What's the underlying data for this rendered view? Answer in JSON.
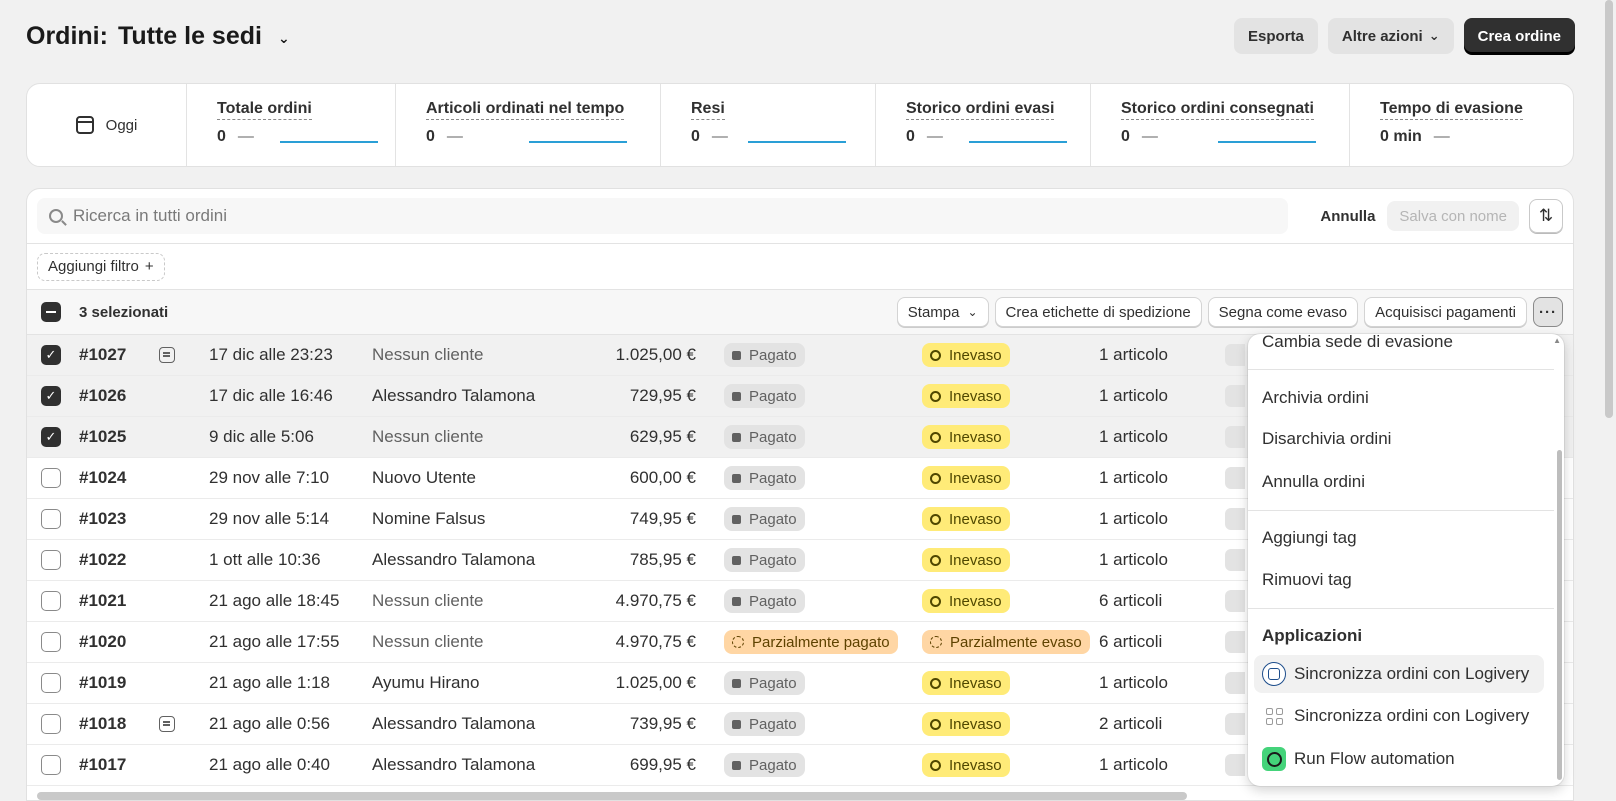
{
  "header": {
    "title_prefix": "Ordini:",
    "title_location": "Tutte le sedi",
    "export_label": "Esporta",
    "more_actions_label": "Altre azioni",
    "create_order_label": "Crea ordine"
  },
  "metrics": {
    "date_label": "Oggi",
    "items": [
      {
        "label": "Totale ordini",
        "value": "0",
        "delta": "—"
      },
      {
        "label": "Articoli ordinati nel tempo",
        "value": "0",
        "delta": "—"
      },
      {
        "label": "Resi",
        "value": "0",
        "delta": "—"
      },
      {
        "label": "Storico ordini evasi",
        "value": "0",
        "delta": "—"
      },
      {
        "label": "Storico ordini consegnati",
        "value": "0",
        "delta": "—"
      },
      {
        "label": "Tempo di evasione",
        "value": "0 min",
        "delta": "—"
      }
    ]
  },
  "search": {
    "placeholder": "Ricerca in tutti ordini",
    "cancel_label": "Annulla",
    "save_label": "Salva con nome"
  },
  "filter": {
    "add_label": "Aggiungi filtro",
    "add_icon": "+"
  },
  "bulk": {
    "count_label": "3 selezionati",
    "print_label": "Stampa",
    "labels_label": "Crea etichette di spedizione",
    "mark_fulfilled_label": "Segna come evaso",
    "capture_label": "Acquisisci pagamenti"
  },
  "orders": [
    {
      "num": "#1027",
      "note": true,
      "date": "17 dic alle 23:23",
      "customer": "Nessun cliente",
      "customer_muted": true,
      "total": "1.025,00 €",
      "payment": "Pagato",
      "payment_style": "gray",
      "fulfillment": "Inevaso",
      "fulfillment_style": "yellow",
      "items": "1 articolo",
      "selected": true
    },
    {
      "num": "#1026",
      "note": false,
      "date": "17 dic alle 16:46",
      "customer": "Alessandro Talamona",
      "customer_muted": false,
      "total": "729,95 €",
      "payment": "Pagato",
      "payment_style": "gray",
      "fulfillment": "Inevaso",
      "fulfillment_style": "yellow",
      "items": "1 articolo",
      "selected": true
    },
    {
      "num": "#1025",
      "note": false,
      "date": "9 dic alle 5:06",
      "customer": "Nessun cliente",
      "customer_muted": true,
      "total": "629,95 €",
      "payment": "Pagato",
      "payment_style": "gray",
      "fulfillment": "Inevaso",
      "fulfillment_style": "yellow",
      "items": "1 articolo",
      "selected": true
    },
    {
      "num": "#1024",
      "note": false,
      "date": "29 nov alle 7:10",
      "customer": "Nuovo Utente",
      "customer_muted": false,
      "total": "600,00 €",
      "payment": "Pagato",
      "payment_style": "gray",
      "fulfillment": "Inevaso",
      "fulfillment_style": "yellow",
      "items": "1 articolo",
      "selected": false
    },
    {
      "num": "#1023",
      "note": false,
      "date": "29 nov alle 5:14",
      "customer": "Nomine Falsus",
      "customer_muted": false,
      "total": "749,95 €",
      "payment": "Pagato",
      "payment_style": "gray",
      "fulfillment": "Inevaso",
      "fulfillment_style": "yellow",
      "items": "1 articolo",
      "selected": false
    },
    {
      "num": "#1022",
      "note": false,
      "date": "1 ott alle 10:36",
      "customer": "Alessandro Talamona",
      "customer_muted": false,
      "total": "785,95 €",
      "payment": "Pagato",
      "payment_style": "gray",
      "fulfillment": "Inevaso",
      "fulfillment_style": "yellow",
      "items": "1 articolo",
      "selected": false
    },
    {
      "num": "#1021",
      "note": false,
      "date": "21 ago alle 18:45",
      "customer": "Nessun cliente",
      "customer_muted": true,
      "total": "4.970,75 €",
      "payment": "Pagato",
      "payment_style": "gray",
      "fulfillment": "Inevaso",
      "fulfillment_style": "yellow",
      "items": "6 articoli",
      "selected": false
    },
    {
      "num": "#1020",
      "note": false,
      "date": "21 ago alle 17:55",
      "customer": "Nessun cliente",
      "customer_muted": true,
      "total": "4.970,75 €",
      "payment": "Parzialmente pagato",
      "payment_style": "orange",
      "fulfillment": "Parzialmente evaso",
      "fulfillment_style": "orange",
      "items": "6 articoli",
      "selected": false
    },
    {
      "num": "#1019",
      "note": false,
      "date": "21 ago alle 1:18",
      "customer": "Ayumu Hirano",
      "customer_muted": false,
      "total": "1.025,00 €",
      "payment": "Pagato",
      "payment_style": "gray",
      "fulfillment": "Inevaso",
      "fulfillment_style": "yellow",
      "items": "1 articolo",
      "selected": false
    },
    {
      "num": "#1018",
      "note": true,
      "date": "21 ago alle 0:56",
      "customer": "Alessandro Talamona",
      "customer_muted": false,
      "total": "739,95 €",
      "payment": "Pagato",
      "payment_style": "gray",
      "fulfillment": "Inevaso",
      "fulfillment_style": "yellow",
      "items": "2 articoli",
      "selected": false
    },
    {
      "num": "#1017",
      "note": false,
      "date": "21 ago alle 0:40",
      "customer": "Alessandro Talamona",
      "customer_muted": false,
      "total": "699,95 €",
      "payment": "Pagato",
      "payment_style": "gray",
      "fulfillment": "Inevaso",
      "fulfillment_style": "yellow",
      "items": "1 articolo",
      "selected": false
    }
  ],
  "menu": {
    "change_location": "Cambia sede di evasione",
    "archive": "Archivia ordini",
    "unarchive": "Disarchivia ordini",
    "cancel": "Annulla ordini",
    "add_tag": "Aggiungi tag",
    "remove_tag": "Rimuovi tag",
    "apps_heading": "Applicazioni",
    "app_sync_1": "Sincronizza ordini con Logivery",
    "app_sync_2": "Sincronizza ordini con Logivery",
    "app_flow": "Run Flow automation"
  }
}
